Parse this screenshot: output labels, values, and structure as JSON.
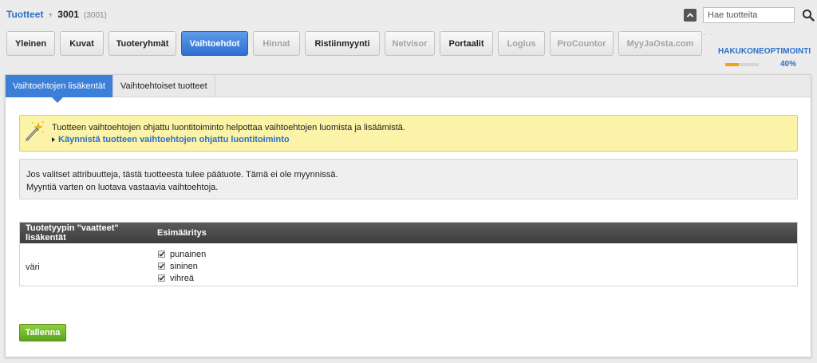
{
  "breadcrumb": {
    "root": "Tuotteet",
    "separator": "+",
    "current": "3001",
    "sub": "(3001)"
  },
  "search": {
    "placeholder": "Hae tuotteita"
  },
  "tabs": [
    {
      "label": "Yleinen",
      "state": "normal"
    },
    {
      "label": "Kuvat",
      "state": "normal"
    },
    {
      "label": "Tuoteryhmät",
      "state": "normal"
    },
    {
      "label": "Vaihtoehdot",
      "state": "active"
    },
    {
      "label": "Hinnat",
      "state": "disabled"
    },
    {
      "label": "Ristiinmyynti",
      "state": "normal"
    },
    {
      "label": "Netvisor",
      "state": "disabled"
    },
    {
      "label": "Portaalit",
      "state": "normal"
    },
    {
      "label": "Logius",
      "state": "disabled"
    },
    {
      "label": "ProCountor",
      "state": "disabled"
    },
    {
      "label": "MyyJaOsta.com",
      "state": "disabled"
    }
  ],
  "more_dots": "· · ·",
  "seo": {
    "title": "HAKUKONEOPTIMOINTI",
    "percent_label": "40%",
    "progress": 0.4,
    "fill_color": "#f0a21a"
  },
  "subtabs": [
    {
      "label": "Vaihtoehtojen lisäkentät",
      "active": true
    },
    {
      "label": "Vaihtoehtoiset tuotteet",
      "active": false
    }
  ],
  "wizard": {
    "icon": "magic-wand-icon",
    "text": "Tuotteen vaihtoehtojen ohjattu luontitoiminto helpottaa vaihtoehtojen luomista ja lisäämistä.",
    "link": "Käynnistä tuotteen vaihtoehtojen ohjattu luontitoiminto"
  },
  "info": {
    "line1": "Jos valitset attribuutteja, tästä tuotteesta tulee päätuote. Tämä ei ole myynnissä.",
    "line2": "Myyntiä varten on luotava vastaavia vaihtoehtoja."
  },
  "table": {
    "headers": [
      "Tuotetyypin \"vaatteet\" lisäkentät",
      "Esimääritys"
    ],
    "rows": [
      {
        "name": "väri",
        "options": [
          {
            "label": "punainen",
            "checked": true
          },
          {
            "label": "sininen",
            "checked": true
          },
          {
            "label": "vihreä",
            "checked": true
          }
        ]
      }
    ]
  },
  "save_label": "Tallenna",
  "colors": {
    "accent": "#3b7fd9",
    "link": "#2a6fc9",
    "save": "#5aa521",
    "notice_bg": "#fbf3a8"
  }
}
